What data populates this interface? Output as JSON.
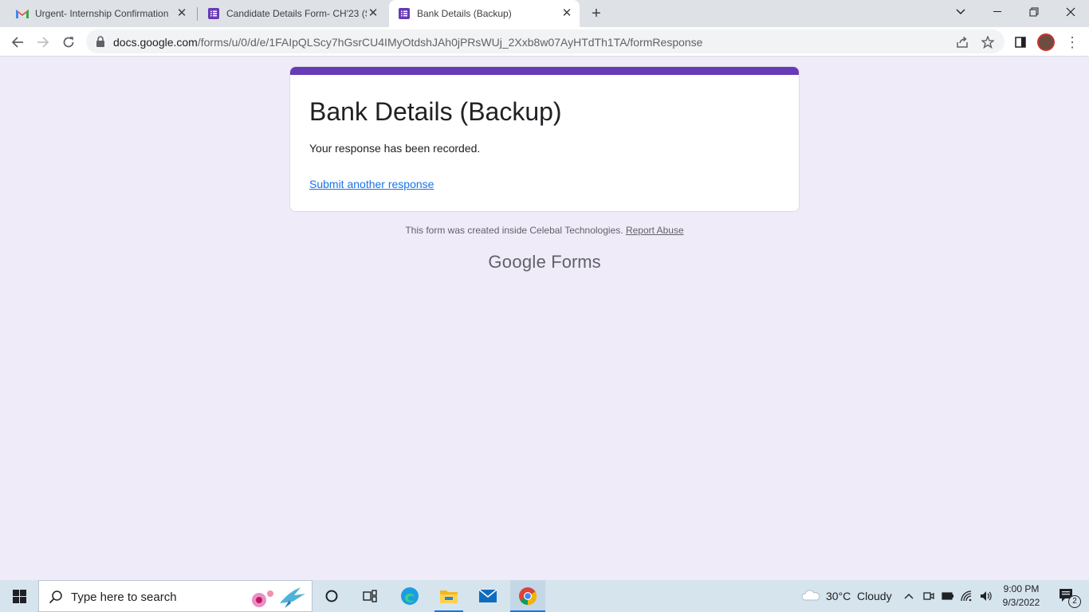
{
  "browser": {
    "tabs": [
      {
        "label": "Urgent- Internship Confirmation",
        "icon": "gmail-icon"
      },
      {
        "label": "Candidate Details Form- CH'23 (S",
        "icon": "forms-icon"
      },
      {
        "label": "Bank Details (Backup)",
        "icon": "forms-icon",
        "active": true
      }
    ],
    "url_host": "docs.google.com",
    "url_path": "/forms/u/0/d/e/1FAIpQLScy7hGsrCU4IMyOtdshJAh0jPRsWUj_2Xxb8w07AyHTdTh1TA/formResponse"
  },
  "form": {
    "title": "Bank Details (Backup)",
    "message": "Your response has been recorded.",
    "submit_another": "Submit another response",
    "accent_color": "#673ab7"
  },
  "footer": {
    "text": "This form was created inside Celebal Technologies.",
    "report_abuse": "Report Abuse",
    "brand_google": "Google",
    "brand_forms": "Forms"
  },
  "taskbar": {
    "search_placeholder": "Type here to search",
    "weather_temp": "30°C",
    "weather_desc": "Cloudy",
    "time": "9:00 PM",
    "date": "9/3/2022",
    "notification_count": "2"
  }
}
